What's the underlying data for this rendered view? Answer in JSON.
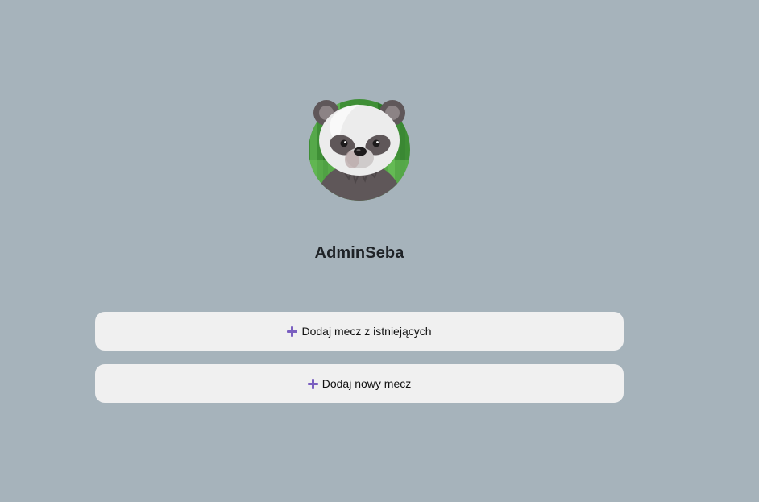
{
  "profile": {
    "username": "AdminSeba",
    "avatar_icon": "panda-avatar-icon"
  },
  "actions": [
    {
      "label": "Dodaj mecz z istniejących",
      "icon": "plus-icon"
    },
    {
      "label": "Dodaj nowy mecz",
      "icon": "plus-icon"
    }
  ],
  "colors": {
    "background": "#a6b3bb",
    "button_bg": "#f0f0f0",
    "icon_accent": "#7a5fc0",
    "avatar_bg": "#3f8f36"
  }
}
